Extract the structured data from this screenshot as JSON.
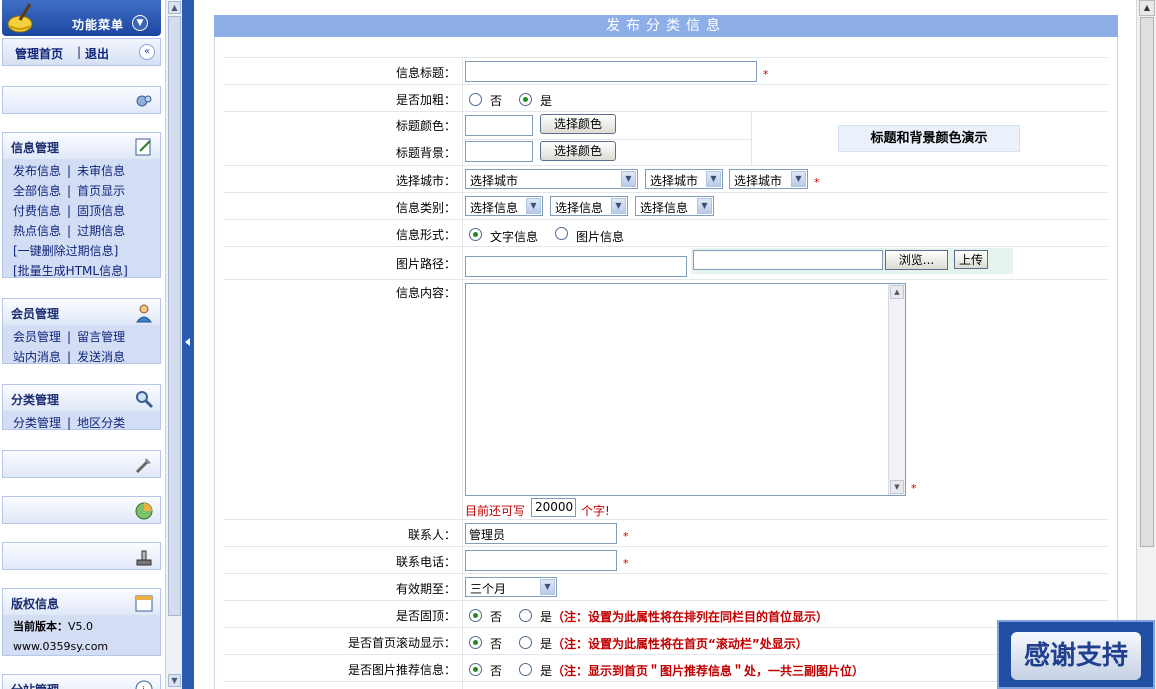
{
  "sidebar": {
    "menu_title": "功能菜单",
    "home_link": "管理首页",
    "logout_link": "退出",
    "sections": {
      "info": {
        "title": "信息管理",
        "links": [
          "发布信息",
          "未审信息",
          "全部信息",
          "首页显示",
          "付费信息",
          "固顶信息",
          "热点信息",
          "过期信息",
          "[一键删除过期信息]",
          "[批量生成HTML信息]"
        ]
      },
      "member": {
        "title": "会员管理",
        "links": [
          "会员管理",
          "留言管理",
          "站内消息",
          "发送消息"
        ]
      },
      "category": {
        "title": "分类管理",
        "links": [
          "分类管理",
          "地区分类"
        ]
      },
      "copyright": {
        "title": "版权信息",
        "version_label": "当前版本：",
        "version": "V5.0",
        "site": "www.0359sy.com"
      },
      "branch": {
        "title": "分站管理"
      }
    }
  },
  "form": {
    "title": "发布分类信息",
    "fields": {
      "title_label": "信息标题：",
      "bold_label": "是否加粗：",
      "no": "否",
      "yes": "是",
      "title_color_label": "标题颜色：",
      "title_bg_label": "标题背景：",
      "choose_color": "选择颜色",
      "color_demo": "标题和背景颜色演示",
      "city_label": "选择城市：",
      "city_select": "选择城市",
      "category_label": "信息类别：",
      "category_select": "选择信息",
      "format_label": "信息形式：",
      "format_text": "文字信息",
      "format_image": "图片信息",
      "image_path_label": "图片路径：",
      "browse": "浏览...",
      "upload": "上传",
      "content_label": "信息内容：",
      "remain_prefix": "目前还可写",
      "remain_value": "20000",
      "remain_suffix": "个字!",
      "contact_label": "联系人：",
      "contact_value": "管理员",
      "phone_label": "联系电话：",
      "expiry_label": "有效期至：",
      "expiry_value": "三个月",
      "top_label": "是否固顶：",
      "top_note": "（注：设置为此属性将在排列在同栏目的首位显示）",
      "scroll_label": "是否首页滚动显示：",
      "scroll_note": "（注：设置为此属性将在首页“滚动栏”处显示）",
      "recommend_label": "是否图片推荐信息：",
      "recommend_note": "（注：显示到首页＂图片推荐信息＂处，一共三副图片位）",
      "required": "*"
    }
  },
  "badge": {
    "text": "感谢支持"
  },
  "colors": {
    "nav_blue": "#1c46a0",
    "header_bar": "#8eaee8",
    "required_red": "#c00000",
    "radio_on": "#1f8a1f"
  }
}
